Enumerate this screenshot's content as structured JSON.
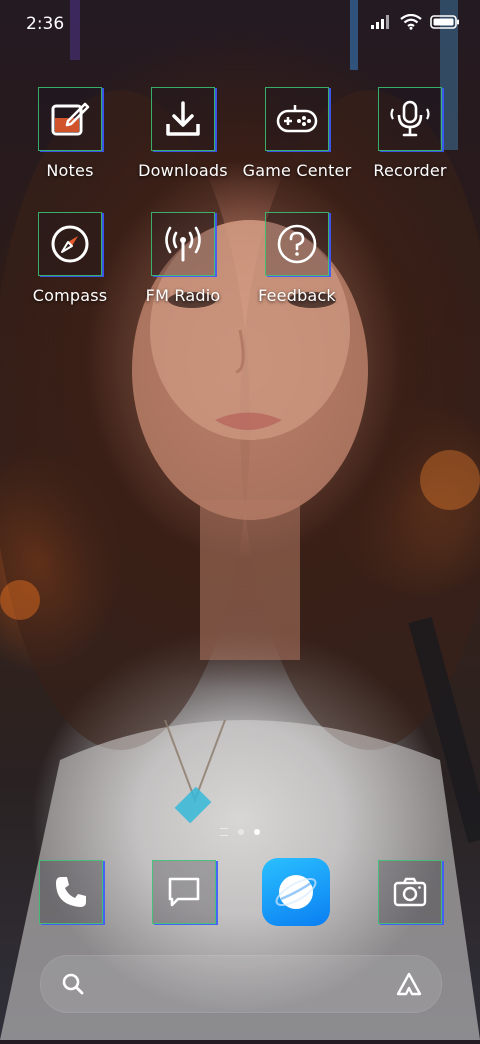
{
  "status_bar": {
    "time": "2:36",
    "icons": [
      "signal-icon",
      "wifi-icon",
      "battery-icon"
    ]
  },
  "home": {
    "apps": [
      {
        "label": "Notes",
        "icon": "notes-icon"
      },
      {
        "label": "Downloads",
        "icon": "download-icon"
      },
      {
        "label": "Game Center",
        "icon": "gamepad-icon"
      },
      {
        "label": "Recorder",
        "icon": "microphone-icon"
      },
      {
        "label": "Compass",
        "icon": "compass-icon"
      },
      {
        "label": "FM Radio",
        "icon": "radio-antenna-icon"
      },
      {
        "label": "Feedback",
        "icon": "question-icon"
      }
    ]
  },
  "page_indicator": {
    "pages": 2,
    "active_page": 2
  },
  "dock": {
    "apps": [
      {
        "icon": "phone-icon"
      },
      {
        "icon": "message-icon"
      },
      {
        "icon": "browser-icon"
      },
      {
        "icon": "camera-icon"
      }
    ]
  },
  "search_bar": {
    "left_icon": "search-icon",
    "right_icon": "assistant-icon"
  },
  "colors": {
    "grid_outline": "#3cc878",
    "grid_shadow": "#3c5aff",
    "browser_blue": "#0a7ef2"
  }
}
